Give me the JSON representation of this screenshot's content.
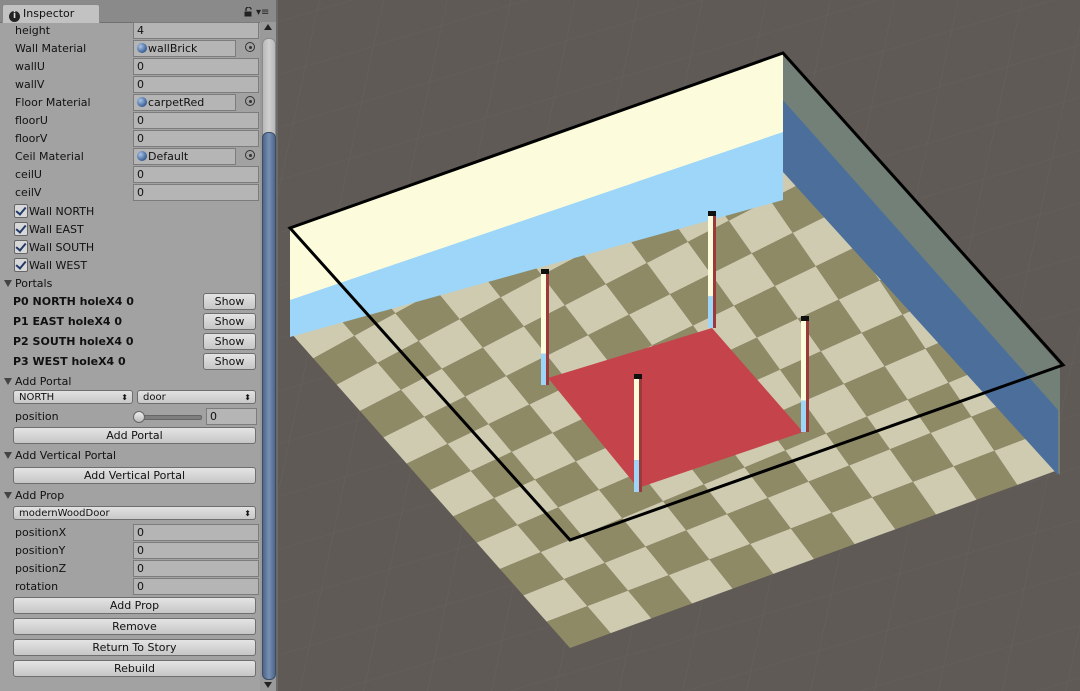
{
  "inspector": {
    "tab_label": "Inspector",
    "fields": [
      {
        "label": "height",
        "value": "4",
        "type": "text"
      },
      {
        "label": "Wall Material",
        "value": "wallBrick",
        "type": "object"
      },
      {
        "label": "wallU",
        "value": "0",
        "type": "text"
      },
      {
        "label": "wallV",
        "value": "0",
        "type": "text"
      },
      {
        "label": "Floor Material",
        "value": "carpetRed",
        "type": "object"
      },
      {
        "label": "floorU",
        "value": "0",
        "type": "text"
      },
      {
        "label": "floorV",
        "value": "0",
        "type": "text"
      },
      {
        "label": "Ceil Material",
        "value": "Default",
        "type": "object"
      },
      {
        "label": "ceilU",
        "value": "0",
        "type": "text"
      },
      {
        "label": "ceilV",
        "value": "0",
        "type": "text"
      }
    ],
    "walls": [
      {
        "label": "Wall NORTH",
        "checked": true
      },
      {
        "label": "Wall EAST",
        "checked": true
      },
      {
        "label": "Wall SOUTH",
        "checked": true
      },
      {
        "label": "Wall WEST",
        "checked": true
      }
    ],
    "portals": {
      "title": "Portals",
      "items": [
        {
          "label": "P0 NORTH holeX4 0",
          "button": "Show"
        },
        {
          "label": "P1 EAST holeX4 0",
          "button": "Show"
        },
        {
          "label": "P2 SOUTH holeX4 0",
          "button": "Show"
        },
        {
          "label": "P3 WEST holeX4 0",
          "button": "Show"
        }
      ]
    },
    "add_portal": {
      "title": "Add Portal",
      "direction": "NORTH",
      "type": "door",
      "position_label": "position",
      "position_value": "0",
      "position_fraction": 0,
      "button": "Add Portal"
    },
    "add_vertical_portal": {
      "title": "Add Vertical Portal",
      "button": "Add Vertical Portal"
    },
    "add_prop": {
      "title": "Add Prop",
      "prop": "modernWoodDoor",
      "fields": [
        {
          "label": "positionX",
          "value": "0"
        },
        {
          "label": "positionY",
          "value": "0"
        },
        {
          "label": "positionZ",
          "value": "0"
        },
        {
          "label": "rotation",
          "value": "0"
        }
      ],
      "button": "Add Prop"
    },
    "buttons": {
      "remove": "Remove",
      "return_to_story": "Return To Story",
      "rebuild": "Rebuild"
    }
  },
  "scene": {
    "background": "#5f5a56",
    "wall_cream": "#fcfcdc",
    "wall_blue": "#9dd6f8",
    "wall_side_gray": "#728078",
    "wall_side_blue": "#4b6f9a",
    "floor_light": "#cfcbb0",
    "floor_dark": "#8f8a66",
    "carpet": "#c5434a",
    "outline": "#000000"
  }
}
